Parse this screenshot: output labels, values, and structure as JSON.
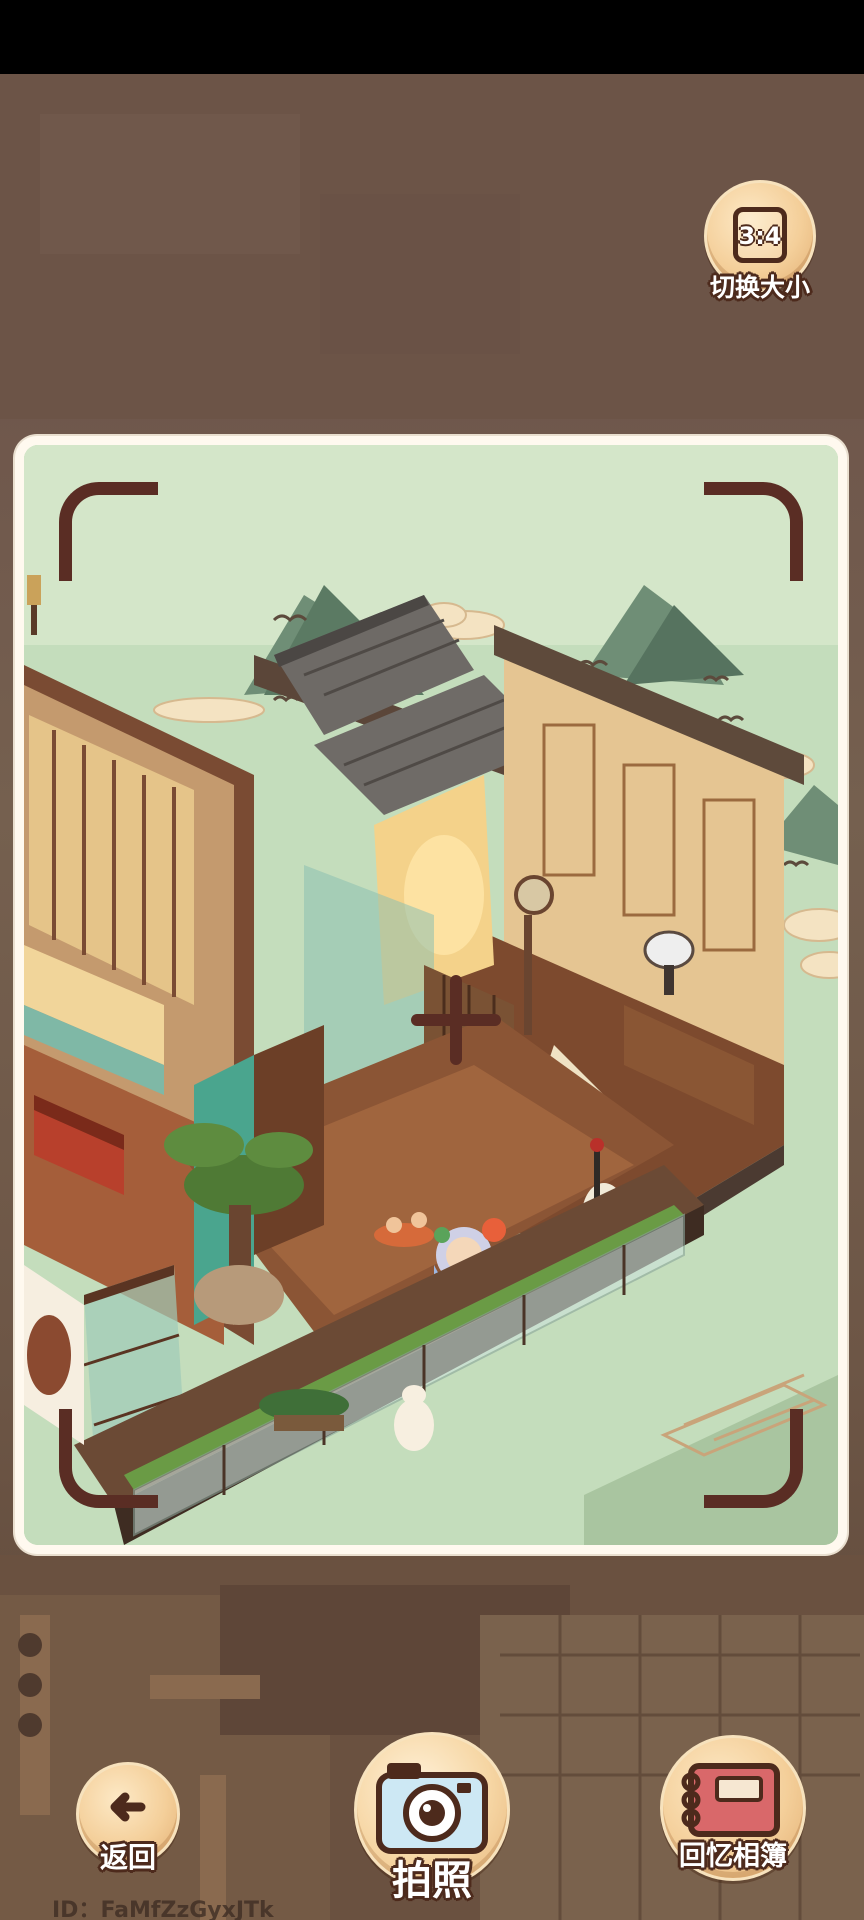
{
  "screen": "photo-mode",
  "top_right": {
    "ratio": "3:4",
    "label": "切换大小"
  },
  "bottom_bar": {
    "back_label": "返回",
    "shutter_label": "拍照",
    "album_label": "回忆相簿"
  },
  "player_id": "ID：FaMfZzGyxJTk",
  "icons": {
    "back": "arrow-left-icon",
    "shutter": "camera-icon",
    "album": "photo-album-icon",
    "ratio": "aspect-ratio-frame-icon"
  },
  "colors": {
    "frame_bracket": "#5a2d24",
    "label_outline": "#4d2a1c",
    "button_face": "#f4cf9a",
    "sky": "#bedbb8",
    "dim_overlay": "#6f574c"
  }
}
